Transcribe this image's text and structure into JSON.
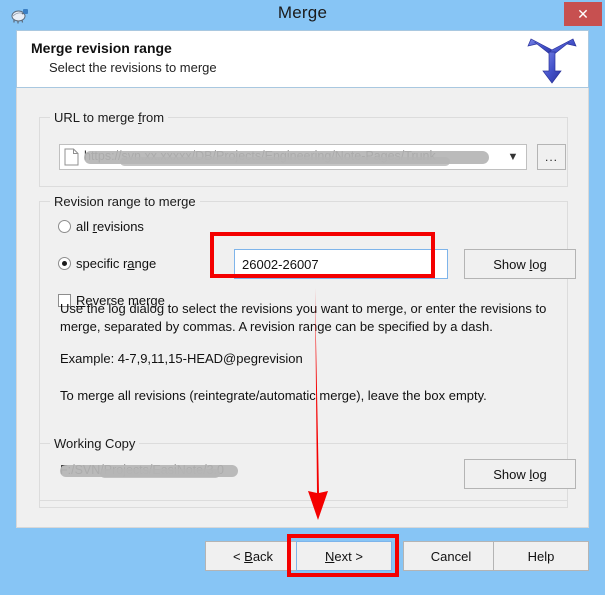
{
  "window": {
    "title": "Merge",
    "icon": "tortoise-icon",
    "close_label": "✕",
    "titlebar_color": "#87c5f5",
    "close_color": "#c75050"
  },
  "header": {
    "title": "Merge revision range",
    "subtitle": "Select the revisions to merge",
    "logo": "merge-arrow-logo",
    "logo_color": "#4a5fd0"
  },
  "url_group": {
    "legend": "URL to merge from",
    "legend_prefix": "URL to merge ",
    "legend_accel": "f",
    "legend_suffix": "rom",
    "combo_value": "https://svn.xx.xxxxx/DB/Projects/Engineering/Note-Pages/Trunk",
    "combo_icon": "file-icon",
    "dropdown_icon": "chevron-down-icon",
    "browse_label": "...",
    "redacted": true
  },
  "revision_group": {
    "legend": "Revision range to merge",
    "all_revisions": {
      "label": "all revisions",
      "prefix": "all ",
      "accel": "r",
      "suffix": "evisions",
      "selected": false
    },
    "specific_range": {
      "label": "specific range",
      "prefix": "specific r",
      "accel": "a",
      "suffix": "nge",
      "selected": true
    },
    "reverse_merge": {
      "label": "Reverse merge",
      "prefix": "",
      "accel": "R",
      "suffix": "everse merge",
      "checked": false
    },
    "range_input": {
      "value": "26002-26007",
      "placeholder": ""
    },
    "show_log_label": "Show log",
    "show_log_prefix": "Show ",
    "show_log_accel": "l",
    "show_log_suffix": "og",
    "description_line_1": "Use the log dialog to select the revisions you want to merge, or enter the revisions to merge, separated by commas. A revision range can be specified by a dash.",
    "description_line_2": "Example: 4-7,9,11,15-HEAD@pegrevision",
    "description_line_3": "To merge all revisions (reintegrate/automatic merge), leave the box empty."
  },
  "working_copy_group": {
    "legend": "Working Copy",
    "path": "F:/SVN/Projects/EasiNote/3.0",
    "show_log_label": "Show log",
    "show_log_prefix": "Show ",
    "show_log_accel": "l",
    "show_log_suffix": "og",
    "redacted": true
  },
  "footer": {
    "back_label": "< Back",
    "back_prefix": "< ",
    "back_accel": "B",
    "back_suffix": "ack",
    "next_label": "Next >",
    "next_accel": "N",
    "next_suffix": "ext >",
    "cancel_label": "Cancel",
    "help_label": "Help"
  },
  "annotations": {
    "color": "#f40000",
    "highlight_input": true,
    "highlight_next_button": true,
    "arrow_from": "revision-range-input",
    "arrow_to": "next-button"
  }
}
